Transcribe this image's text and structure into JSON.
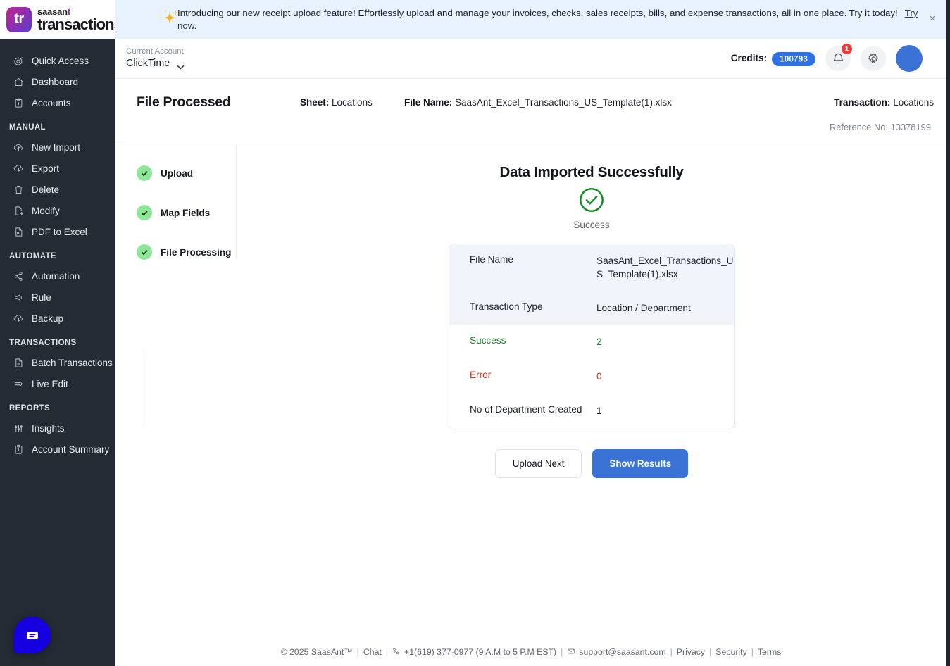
{
  "brand": {
    "mark": "tr",
    "name_line1": "saasan",
    "name_line1_accent": "t",
    "name_line2": "transactions"
  },
  "banner": {
    "icon": "sparkle-icon",
    "text": "Introducing our new receipt upload feature! Effortlessly upload and manage your invoices, checks, sales receipts, bills, and expense transactions, all in one place. Try it today!",
    "link_label": "Try now.",
    "close_label": "×"
  },
  "topbar": {
    "account_label": "Current Account",
    "account_value": "ClickTime",
    "credits_label": "Credits:",
    "credits_value": "100793",
    "notification_count": "1",
    "icons": {
      "bell": "bell-icon",
      "gear": "gear-icon",
      "avatar": "user-avatar"
    }
  },
  "sidebar": {
    "groups": [
      {
        "title": "",
        "items": [
          {
            "label": "Quick Access",
            "icon": "target-icon"
          },
          {
            "label": "Dashboard",
            "icon": "home-icon"
          },
          {
            "label": "Accounts",
            "icon": "clipboard-icon"
          }
        ]
      },
      {
        "title": "MANUAL",
        "items": [
          {
            "label": "New Import",
            "icon": "upload-cloud-icon"
          },
          {
            "label": "Export",
            "icon": "download-cloud-icon"
          },
          {
            "label": "Delete",
            "icon": "trash-icon"
          },
          {
            "label": "Modify",
            "icon": "file-edit-icon"
          },
          {
            "label": "PDF to Excel",
            "icon": "pdf-file-icon"
          }
        ]
      },
      {
        "title": "AUTOMATE",
        "items": [
          {
            "label": "Automation",
            "icon": "share-nodes-icon"
          },
          {
            "label": "Rule",
            "icon": "megaphone-icon"
          },
          {
            "label": "Backup",
            "icon": "download-cloud-icon"
          }
        ]
      },
      {
        "title": "TRANSACTIONS",
        "items": [
          {
            "label": "Batch Transactions",
            "icon": "document-icon"
          },
          {
            "label": "Live Edit",
            "icon": "list-arrow-icon"
          }
        ]
      },
      {
        "title": "REPORTS",
        "items": [
          {
            "label": "Insights",
            "icon": "sliders-icon"
          },
          {
            "label": "Account Summary",
            "icon": "clipboard-icon"
          }
        ]
      }
    ],
    "chat_widget": "chat-bubble-icon"
  },
  "pagehead": {
    "title": "File Processed",
    "sheet_label": "Sheet:",
    "sheet_value": "Locations",
    "filename_label": "File Name:",
    "filename_value": "SaasAnt_Excel_Transactions_US_Template(1).xlsx",
    "transaction_label": "Transaction:",
    "transaction_value": "Locations",
    "reference": "Reference No: 13378199"
  },
  "steps": [
    {
      "label": "Upload",
      "state": "complete"
    },
    {
      "label": "Map Fields",
      "state": "complete"
    },
    {
      "label": "File Processing",
      "state": "complete"
    }
  ],
  "result": {
    "title": "Data Imported Successfully",
    "icon": "check-circle-icon",
    "subtitle": "Success",
    "rows": [
      {
        "key": "File Name",
        "value": "SaasAnt_Excel_Transactions_US_Template(1).xlsx",
        "style": "tinted"
      },
      {
        "key": "Transaction Type",
        "value": "Location / Department",
        "style": "tinted"
      },
      {
        "key": "Success",
        "value": "2",
        "style": "success"
      },
      {
        "key": "Error",
        "value": "0",
        "style": "error"
      },
      {
        "key": "No of Department Created",
        "value": "1",
        "style": "plain"
      }
    ],
    "buttons": {
      "secondary": "Upload Next",
      "primary": "Show Results"
    }
  },
  "footer": {
    "copyright": "© 2025 SaasAnt™",
    "chat": "Chat",
    "phone": "+1(619) 377-0977 (9 A.M to 5 P.M EST)",
    "email": "support@saasant.com",
    "privacy": "Privacy",
    "security": "Security",
    "terms": "Terms"
  },
  "colors": {
    "accent_blue": "#3a72d6",
    "banner_bg": "#e8f2fd",
    "success_green": "#1d7a2b",
    "error_red": "#c0392b",
    "step_green": "#8ce896",
    "sidebar_bg": "#252b35"
  }
}
